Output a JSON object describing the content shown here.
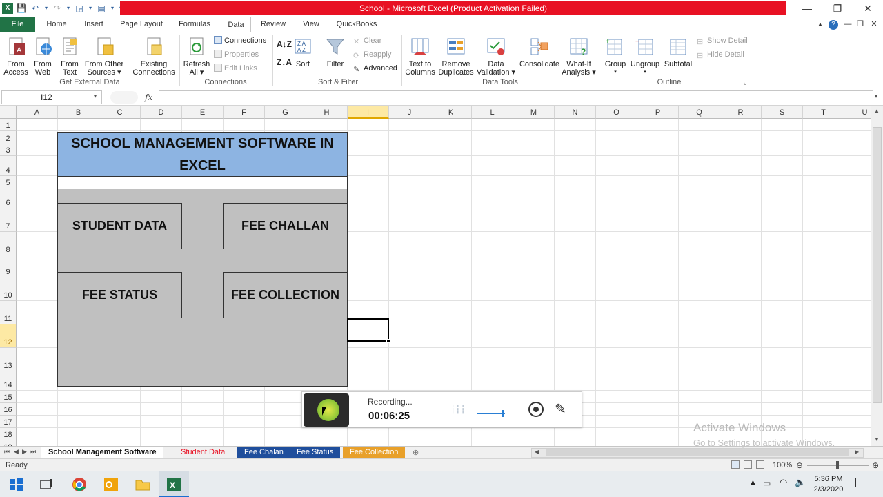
{
  "window": {
    "title": "School -  Microsoft Excel (Product Activation Failed)",
    "accent": "#217346",
    "title_bar_color": "#e81123"
  },
  "ribbon_tabs": [
    "File",
    "Home",
    "Insert",
    "Page Layout",
    "Formulas",
    "Data",
    "Review",
    "View",
    "QuickBooks"
  ],
  "active_tab": "Data",
  "ribbon": {
    "get_external_data": {
      "label": "Get External Data",
      "from_access": [
        "From",
        "Access"
      ],
      "from_web": [
        "From",
        "Web"
      ],
      "from_text": [
        "From",
        "Text"
      ],
      "from_other": [
        "From Other",
        "Sources ▾"
      ],
      "existing": [
        "Existing",
        "Connections"
      ]
    },
    "connections": {
      "label": "Connections",
      "refresh": [
        "Refresh",
        "All ▾"
      ],
      "connections": "Connections",
      "properties": "Properties",
      "edit_links": "Edit Links"
    },
    "sort_filter": {
      "label": "Sort & Filter",
      "sort": "Sort",
      "filter": "Filter",
      "clear": "Clear",
      "reapply": "Reapply",
      "advanced": "Advanced"
    },
    "data_tools": {
      "label": "Data Tools",
      "text_to_columns": [
        "Text to",
        "Columns"
      ],
      "remove_duplicates": [
        "Remove",
        "Duplicates"
      ],
      "data_validation": [
        "Data",
        "Validation ▾"
      ],
      "consolidate": "Consolidate",
      "what_if": [
        "What-If",
        "Analysis ▾"
      ]
    },
    "outline": {
      "label": "Outline",
      "group": "Group",
      "ungroup": "Ungroup",
      "subtotal": "Subtotal",
      "show_detail": "Show Detail",
      "hide_detail": "Hide Detail"
    }
  },
  "formula_bar": {
    "name_box": "I12",
    "fx": "fx",
    "formula": ""
  },
  "columns": [
    "A",
    "B",
    "C",
    "D",
    "E",
    "F",
    "G",
    "H",
    "I",
    "J",
    "K",
    "L",
    "M",
    "N",
    "O",
    "P",
    "Q",
    "R",
    "S",
    "T",
    "U"
  ],
  "rows": [
    "1",
    "2",
    "3",
    "4",
    "5",
    "6",
    "7",
    "8",
    "9",
    "10",
    "11",
    "12",
    "13",
    "14",
    "15",
    "16",
    "17",
    "18",
    "19"
  ],
  "selected_cell": {
    "column": "I",
    "row": "12"
  },
  "school_panel": {
    "title": [
      "SCHOOL MANAGEMENT SOFTWARE IN",
      "EXCEL"
    ],
    "buttons": [
      "STUDENT DATA",
      "FEE CHALLAN",
      "FEE STATUS",
      "FEE COLLECTION"
    ],
    "title_bg": "#8db4e2",
    "panel_bg": "#c0c0c0"
  },
  "sheet_tabs": [
    {
      "name": "School Management Software",
      "color": "#111111"
    },
    {
      "name": "Student Data",
      "color": "#e81123"
    },
    {
      "name": "Fee Chalan",
      "color": "#1f4e9c"
    },
    {
      "name": "Fee Status",
      "color": "#1f4e9c"
    },
    {
      "name": "Fee Collection",
      "color": "#e8a02a"
    }
  ],
  "status_bar": {
    "ready": "Ready",
    "zoom": "100%"
  },
  "recording": {
    "status": "Recording...",
    "time": "00:06:25"
  },
  "watermark": {
    "line1": "Activate Windows",
    "line2": "Go to Settings to activate Windows."
  },
  "taskbar": {
    "time": "5:36 PM",
    "date": "2/3/2020"
  }
}
